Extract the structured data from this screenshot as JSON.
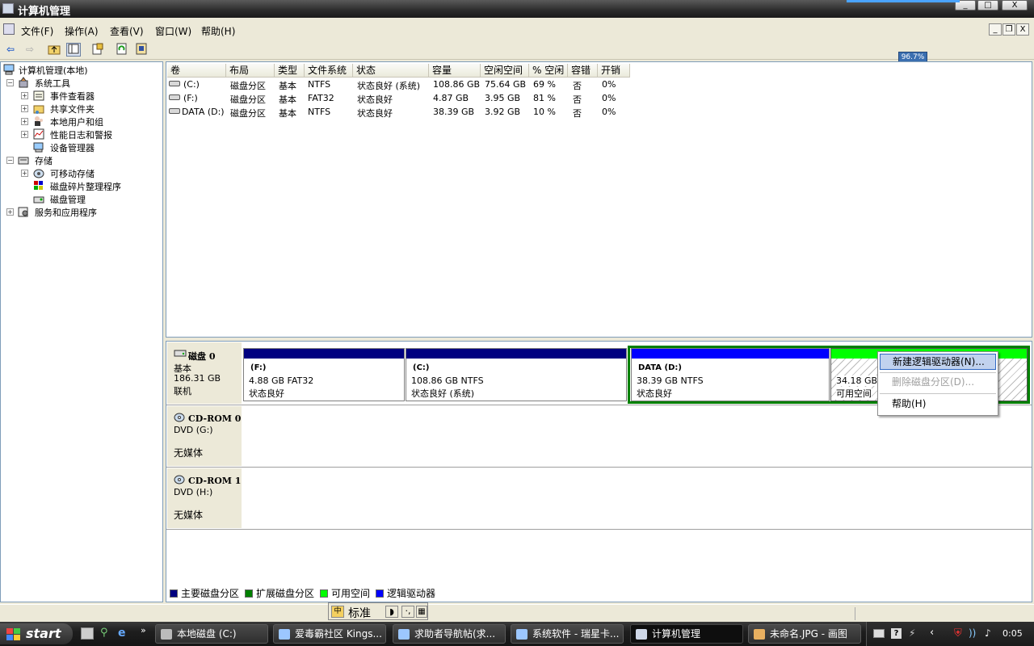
{
  "window": {
    "title": "计算机管理",
    "min": "_",
    "max": "□",
    "close": "X"
  },
  "menu": {
    "items": [
      "文件(F)",
      "操作(A)",
      "查看(V)",
      "窗口(W)",
      "帮助(H)"
    ]
  },
  "mdi": {
    "min": "_",
    "restore": "❐",
    "close": "X"
  },
  "toolbar": {
    "icons": [
      "back-arrow-icon",
      "forward-arrow-icon",
      "up-folder-icon",
      "show-hide-tree-icon",
      "properties-icon",
      "refresh-icon",
      "help-icon"
    ]
  },
  "tree": {
    "root": "计算机管理(本地)",
    "system_tools": "系统工具",
    "event_viewer": "事件查看器",
    "shared_folders": "共享文件夹",
    "local_users": "本地用户和组",
    "perf_logs": "性能日志和警报",
    "device_manager": "设备管理器",
    "storage": "存储",
    "removable": "可移动存储",
    "defrag": "磁盘碎片整理程序",
    "disk_mgmt": "磁盘管理",
    "services": "服务和应用程序"
  },
  "volumes": {
    "headers": [
      "卷",
      "布局",
      "类型",
      "文件系统",
      "状态",
      "容量",
      "空闲空间",
      "% 空闲",
      "容错",
      "开销"
    ],
    "rows": [
      [
        "(C:)",
        "磁盘分区",
        "基本",
        "NTFS",
        "状态良好 (系统)",
        "108.86 GB",
        "75.64 GB",
        "69 %",
        "否",
        "0%"
      ],
      [
        "(F:)",
        "磁盘分区",
        "基本",
        "FAT32",
        "状态良好",
        "4.87 GB",
        "3.95 GB",
        "81 %",
        "否",
        "0%"
      ],
      [
        "DATA (D:)",
        "磁盘分区",
        "基本",
        "NTFS",
        "状态良好",
        "38.39 GB",
        "3.92 GB",
        "10 %",
        "否",
        "0%"
      ]
    ]
  },
  "zoom": {
    "value": "96.7%"
  },
  "disks": {
    "disk0": {
      "name": "磁盘 0",
      "type": "基本",
      "size": "186.31 GB",
      "status": "联机"
    },
    "cd0": {
      "name": "CD-ROM 0",
      "drive": "DVD (G:)",
      "media": "无媒体"
    },
    "cd1": {
      "name": "CD-ROM 1",
      "drive": "DVD (H:)",
      "media": "无媒体"
    }
  },
  "partitions": {
    "f": {
      "label": "(F:)",
      "size": "4.88 GB FAT32",
      "status": "状态良好"
    },
    "c": {
      "label": "(C:)",
      "size": "108.86 GB NTFS",
      "status": "状态良好 (系统)"
    },
    "d": {
      "label": "DATA  (D:)",
      "size": "38.39 GB NTFS",
      "status": "状态良好"
    },
    "free": {
      "size": "34.18 GB",
      "status": "可用空间"
    }
  },
  "colors": {
    "primary": "#000080",
    "extended": "#008000",
    "free": "#00ff00",
    "logical": "#0000ff"
  },
  "legend": {
    "primary": "主要磁盘分区",
    "extended": "扩展磁盘分区",
    "free": "可用空间",
    "logical": "逻辑驱动器"
  },
  "context_menu": {
    "new_logical": "新建逻辑驱动器(N)...",
    "delete_partition": "删除磁盘分区(D)...",
    "help": "帮助(H)"
  },
  "ime": {
    "mode": "标准"
  },
  "taskbar": {
    "start": "start",
    "tasks": [
      "本地磁盘 (C:)",
      "爱毒霸社区 Kings...",
      "求助者导航帖(求...",
      "系统软件 - 瑞星卡...",
      "计算机管理",
      "未命名.JPG - 画图"
    ],
    "clock": "0:05"
  }
}
